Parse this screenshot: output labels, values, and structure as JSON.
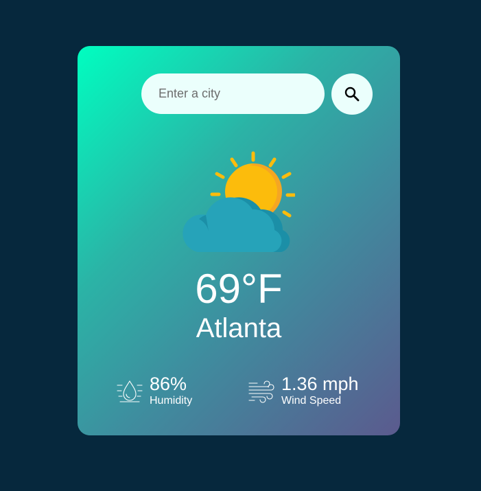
{
  "search": {
    "placeholder": "Enter a city",
    "value": ""
  },
  "weather": {
    "icon": "sun-behind-cloud-icon",
    "temperature": "69°F",
    "city": "Atlanta"
  },
  "details": {
    "humidity": {
      "value": "86%",
      "label": "Humidity",
      "icon": "humidity-icon"
    },
    "wind": {
      "value": "1.36 mph",
      "label": "Wind Speed",
      "icon": "wind-icon"
    }
  },
  "colors": {
    "background": "#06283d",
    "gradient_start": "#00fec0",
    "gradient_end": "#5b5a8e",
    "input_bg": "#ebfffc",
    "sun": "#fcbc0c",
    "sun_shade": "#f5a623",
    "cloud": "#26a3b9",
    "cloud_shade": "#1b8fa7"
  }
}
